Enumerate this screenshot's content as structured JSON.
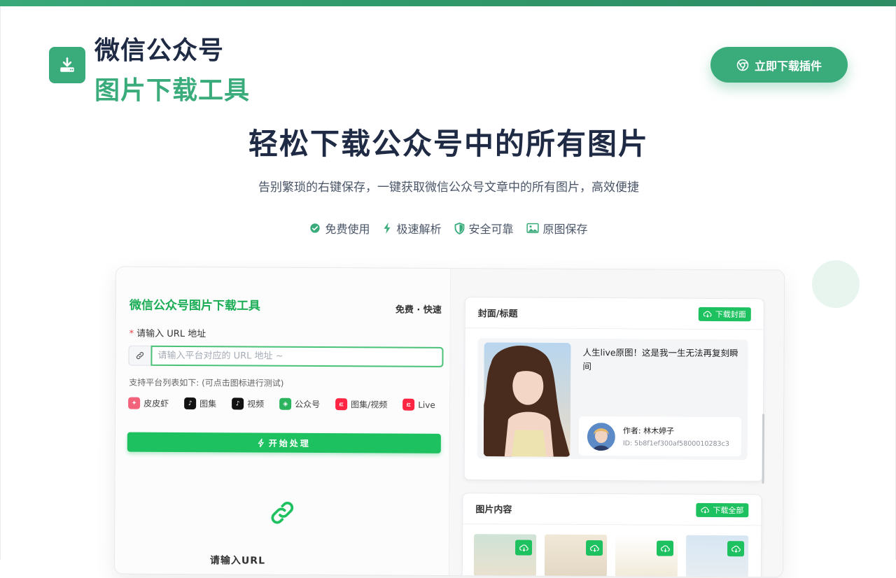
{
  "brand": {
    "line1": "微信公众号",
    "line2": "图片下载工具",
    "logo_icon": "download-icon"
  },
  "cta": {
    "label": "立即下载插件",
    "icon": "chrome-icon"
  },
  "hero": {
    "title": "轻松下载公众号中的所有图片",
    "subtitle": "告别繁琐的右键保存，一键获取微信公众号文章中的所有图片，高效便捷"
  },
  "features": [
    {
      "label": "免费使用",
      "icon": "check-circle-icon"
    },
    {
      "label": "极速解析",
      "icon": "lightning-icon"
    },
    {
      "label": "安全可靠",
      "icon": "shield-icon"
    },
    {
      "label": "原图保存",
      "icon": "image-icon"
    }
  ],
  "tool": {
    "title": "微信公众号图片下载工具",
    "tagline": "免费 · 快速",
    "url_label": "请输入 URL 地址",
    "url_required_mark": "*",
    "url_placeholder": "请输入平台对应的 URL 地址 ~",
    "support_text": "支持平台列表如下: (可点击图标进行测试)",
    "platforms": [
      {
        "label": "皮皮虾",
        "icon": "pipixia-icon",
        "color": "#f2637b"
      },
      {
        "label": "图集",
        "icon": "tiktok-icon",
        "color": "#111111"
      },
      {
        "label": "视频",
        "icon": "tiktok-icon",
        "color": "#111111"
      },
      {
        "label": "公众号",
        "icon": "wechat-icon",
        "color": "#2bb35d"
      },
      {
        "label": "图集/视频",
        "icon": "xiaohongshu-icon",
        "color": "#ff2442"
      },
      {
        "label": "Live",
        "icon": "xiaohongshu-icon",
        "color": "#ff2442"
      }
    ],
    "start_label": "开始处理",
    "partial_text": "请输入URL"
  },
  "cover_card": {
    "title": "封面/标题",
    "download_label": "下载封面",
    "article_title": "人生live原图！这是我一生无法再复刻瞬间",
    "author_label": "作者: 林木婷子",
    "author_id": "ID: 5b8f1ef300af5800010283c3"
  },
  "images_card": {
    "title": "图片内容",
    "download_label": "下载全部",
    "thumb_count_shown": 4
  },
  "colors": {
    "accent": "#3aac7c",
    "button_green": "#1ec15f",
    "title_green": "#1aad55",
    "dark": "#1f2a44"
  }
}
